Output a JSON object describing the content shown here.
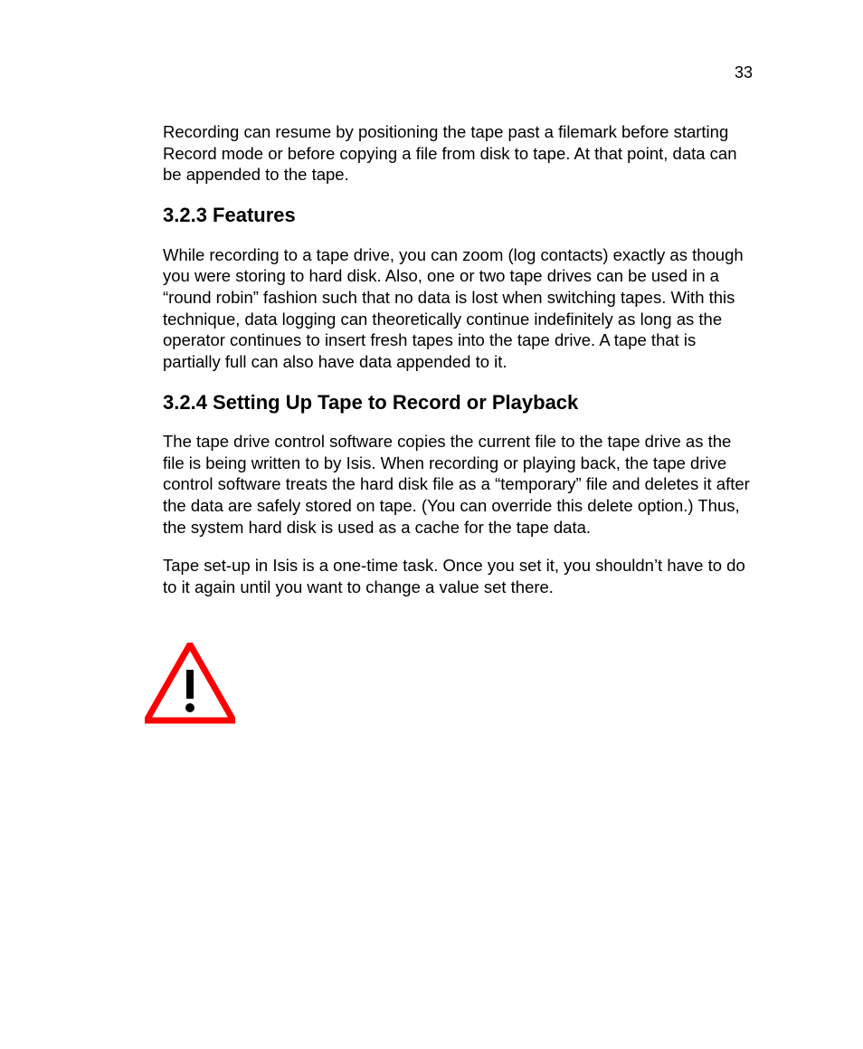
{
  "pageNumber": "33",
  "intro": "Recording can resume by positioning the tape past a filemark before starting Record mode or before copying a file from disk to tape. At that point, data can be appended to the tape.",
  "sections": [
    {
      "heading": "3.2.3 Features",
      "paragraphs": [
        "While recording to a tape drive, you can zoom (log contacts) exactly as though you were storing to hard disk. Also, one or two tape drives can be used in a “round robin” fashion such that no data is lost when switching tapes. With this technique, data logging can theoretically continue indefinitely as long as the operator continues to insert fresh tapes into the tape drive. A tape that is partially full can also have data appended to it."
      ]
    },
    {
      "heading": "3.2.4 Setting Up Tape to Record or Playback",
      "paragraphs": [
        "The tape drive control software copies the current file to the tape drive as the file is being written to by Isis. When recording or playing back, the tape drive control software treats the hard disk file as a “temporary” file and deletes it after the data are safely stored on tape. (You can override this delete option.) Thus, the system hard disk is used as a cache for the tape data.",
        "Tape set-up in Isis is a one-time task. Once you set it, you shouldn’t have to do to it again until you want to change a value set there."
      ]
    }
  ],
  "warning": {
    "iconName": "warning-triangle-icon"
  }
}
